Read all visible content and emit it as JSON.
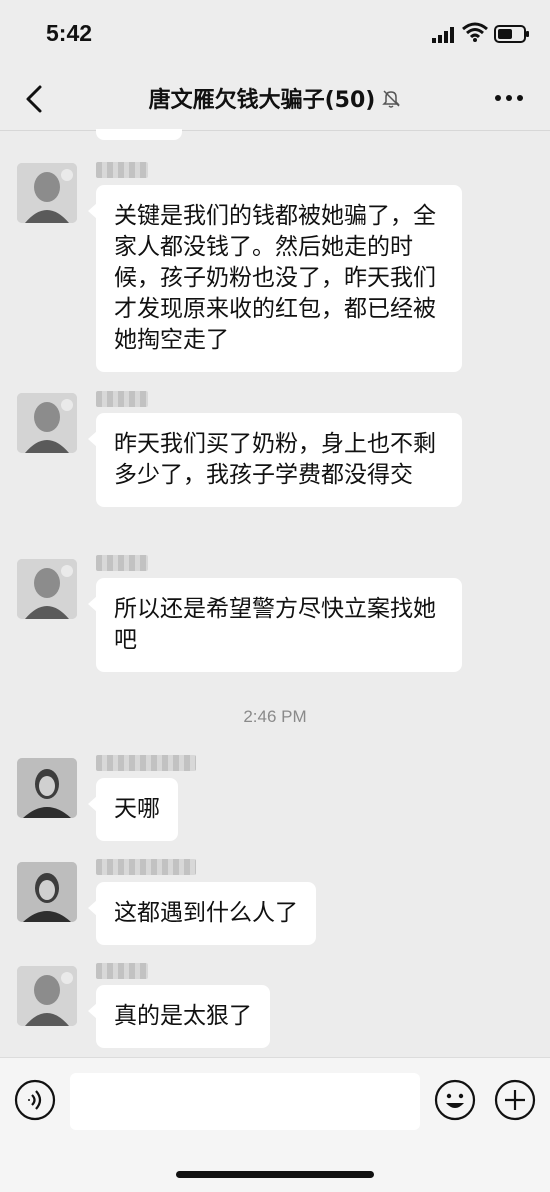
{
  "status_bar": {
    "time": "5:42"
  },
  "nav": {
    "title": "唐文雁欠钱大骗子(50)",
    "muted_icon": "bell-slash-icon",
    "back_icon": "chevron-left-icon",
    "more_icon": "more-dots-icon"
  },
  "messages": [
    {
      "text": "关键是我们的钱都被她骗了，全家人都没钱了。然后她走的时候，孩子奶粉也没了，昨天我们才发现原来收的红包，都已经被她掏空走了"
    },
    {
      "text": "昨天我们买了奶粉，身上也不剩多少了，我孩子学费都没得交"
    },
    {
      "text": "所以还是希望警方尽快立案找她吧"
    },
    {
      "text": "天哪"
    },
    {
      "text": "这都遇到什么人了"
    },
    {
      "text": "真的是太狠了"
    }
  ],
  "time_divider": "2:46 PM",
  "colors": {
    "background": "#ececec",
    "bubble": "#ffffff",
    "input_bar": "#f5f5f5"
  }
}
